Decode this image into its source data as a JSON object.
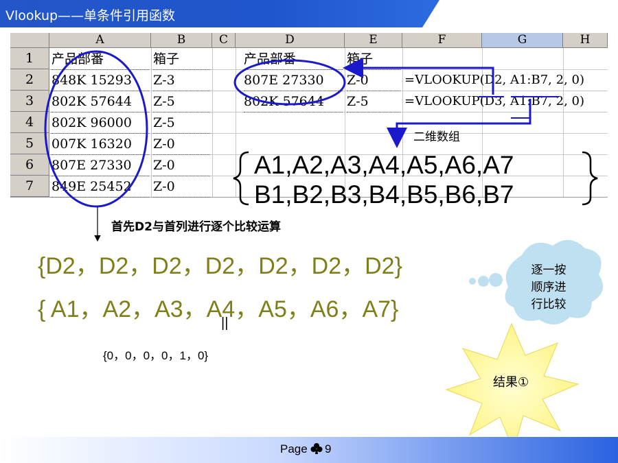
{
  "title": "Vlookup——单条件引用函数",
  "colors": {
    "banner": "#1f4fbf",
    "ellipse": "#1a1acc",
    "arrow": "#1a1acc",
    "olive": "#7f7f1a",
    "cloud": "#bfe0f0",
    "burst": "#ffffa0"
  },
  "sheet": {
    "columns": [
      "A",
      "B",
      "C",
      "D",
      "E",
      "F",
      "G",
      "H"
    ],
    "rows": [
      "1",
      "2",
      "3",
      "4",
      "5",
      "6",
      "7"
    ],
    "colA": [
      "产品部番",
      "848K 15293",
      "802K 57644",
      "802K 96000",
      "007K 16320",
      "807E 27330",
      "849E 25452"
    ],
    "colB": [
      "箱子",
      "Z-3",
      "Z-5",
      "Z-5",
      "Z-0",
      "Z-0",
      "Z-0"
    ],
    "colD": [
      "产品部番",
      "807E 27330",
      "802K 57644"
    ],
    "colE": [
      "箱子",
      "Z-0",
      "Z-5"
    ],
    "formulas": [
      "=VLOOKUP(D2, A1:B7, 2, 0)",
      "=VLOOKUP(D3, A1:B7, 2, 0)"
    ]
  },
  "label_2d_array": "二维数组",
  "array_row1": "A1,A2,A3,A4,A5,A6,A7",
  "array_row2": "B1,B2,B3,B4,B5,B6,B7",
  "compare_note": "首先D2与首列进行逐个比较运算",
  "d2_row": "{D2，D2，D2，D2，D2，D2，D2}",
  "a_row": "{ A1，A2，A3，A4，A5，A6，A7}",
  "equals_mark": "||",
  "result_array": "{0，0，0，0，1，0}",
  "cloud_text": [
    "逐一按",
    "顺序进",
    "行比较"
  ],
  "burst_text": "结果①",
  "footer": {
    "page_label": "Page",
    "page_icon": "club-icon",
    "page_number": "9"
  }
}
